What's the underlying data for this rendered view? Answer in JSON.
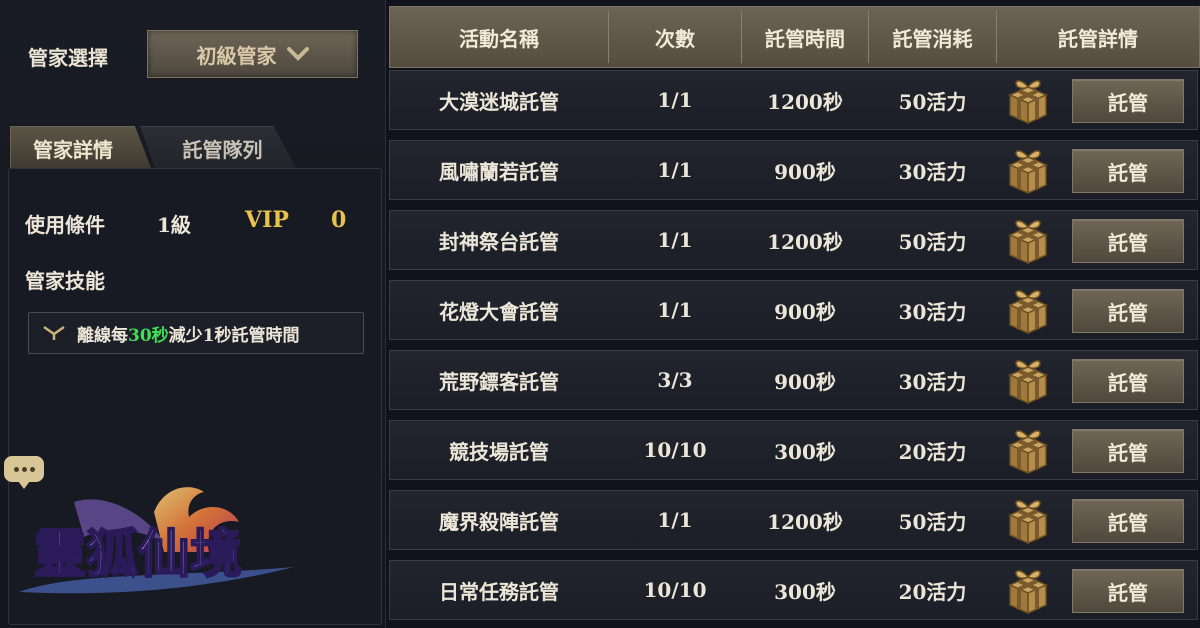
{
  "manager": {
    "select_label": "管家選擇",
    "selected": "初級管家"
  },
  "tabs": [
    {
      "label": "管家詳情",
      "active": true
    },
    {
      "label": "託管隊列",
      "active": false
    }
  ],
  "details": {
    "condition_label": "使用條件",
    "condition_level": "1級",
    "vip_label": "VIP",
    "vip_value": "0",
    "skill_label": "管家技能",
    "skill_text_pre": "離線每",
    "skill_text_highlight": "30秒",
    "skill_text_post": "減少1秒託管時間"
  },
  "logo": {
    "text": "靈狐仙境"
  },
  "table": {
    "headers": [
      "活動名稱",
      "次數",
      "託管時間",
      "託管消耗",
      "託管詳情"
    ],
    "button_label": "託管",
    "rows": [
      {
        "name": "大漠迷城託管",
        "count": "1/1",
        "time": "1200秒",
        "cost": "50活力"
      },
      {
        "name": "風嘯蘭若託管",
        "count": "1/1",
        "time": "900秒",
        "cost": "30活力"
      },
      {
        "name": "封神祭台託管",
        "count": "1/1",
        "time": "1200秒",
        "cost": "50活力"
      },
      {
        "name": "花燈大會託管",
        "count": "1/1",
        "time": "900秒",
        "cost": "30活力"
      },
      {
        "name": "荒野鏢客託管",
        "count": "3/3",
        "time": "900秒",
        "cost": "30活力"
      },
      {
        "name": "競技場託管",
        "count": "10/10",
        "time": "300秒",
        "cost": "20活力"
      },
      {
        "name": "魔界殺陣託管",
        "count": "1/1",
        "time": "1200秒",
        "cost": "50活力"
      },
      {
        "name": "日常任務託管",
        "count": "10/10",
        "time": "300秒",
        "cost": "20活力"
      }
    ]
  },
  "colors": {
    "accent_gold": "#e8c24a",
    "highlight_green": "#3ee056",
    "button_bronze": "#5f574a"
  },
  "icons": [
    "chevron-down-icon",
    "skill-arrow-icon",
    "chat-icon",
    "gift-box-icon"
  ]
}
